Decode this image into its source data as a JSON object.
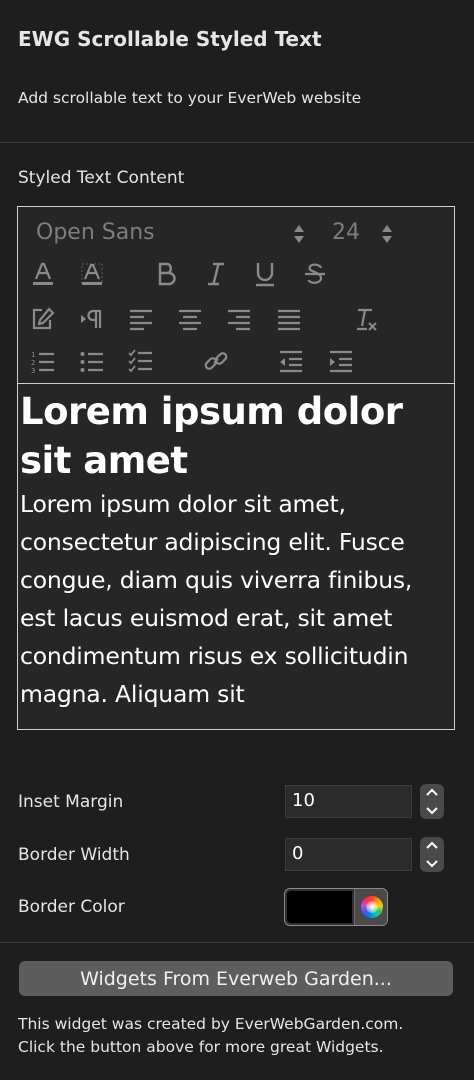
{
  "header": {
    "title": "EWG Scrollable Styled Text",
    "subtitle": "Add scrollable text to your EverWeb website"
  },
  "editor": {
    "label": "Styled Text Content",
    "font_name": "Open Sans",
    "font_size": "24",
    "heading": "Lorem ipsum dolor sit amet",
    "body": "Lorem ipsum dolor sit amet, consectetur adipiscing elit. Fusce congue, diam quis viverra finibus, est lacus euismod erat, sit amet condimentum risus ex sollicitudin magna. Aliquam sit"
  },
  "settings": {
    "inset_margin_label": "Inset Margin",
    "inset_margin_value": "10",
    "border_width_label": "Border Width",
    "border_width_value": "0",
    "border_color_label": "Border Color",
    "border_color_value": "#000000"
  },
  "footer": {
    "button_label": "Widgets From Everweb Garden...",
    "line1": "This widget was created by EverWebGarden.com.",
    "line2": "Click the button above for more great Widgets."
  },
  "colors": {
    "background": "#1e1e1e",
    "button": "#5d5d5d",
    "icon": "#8a8a8a"
  }
}
